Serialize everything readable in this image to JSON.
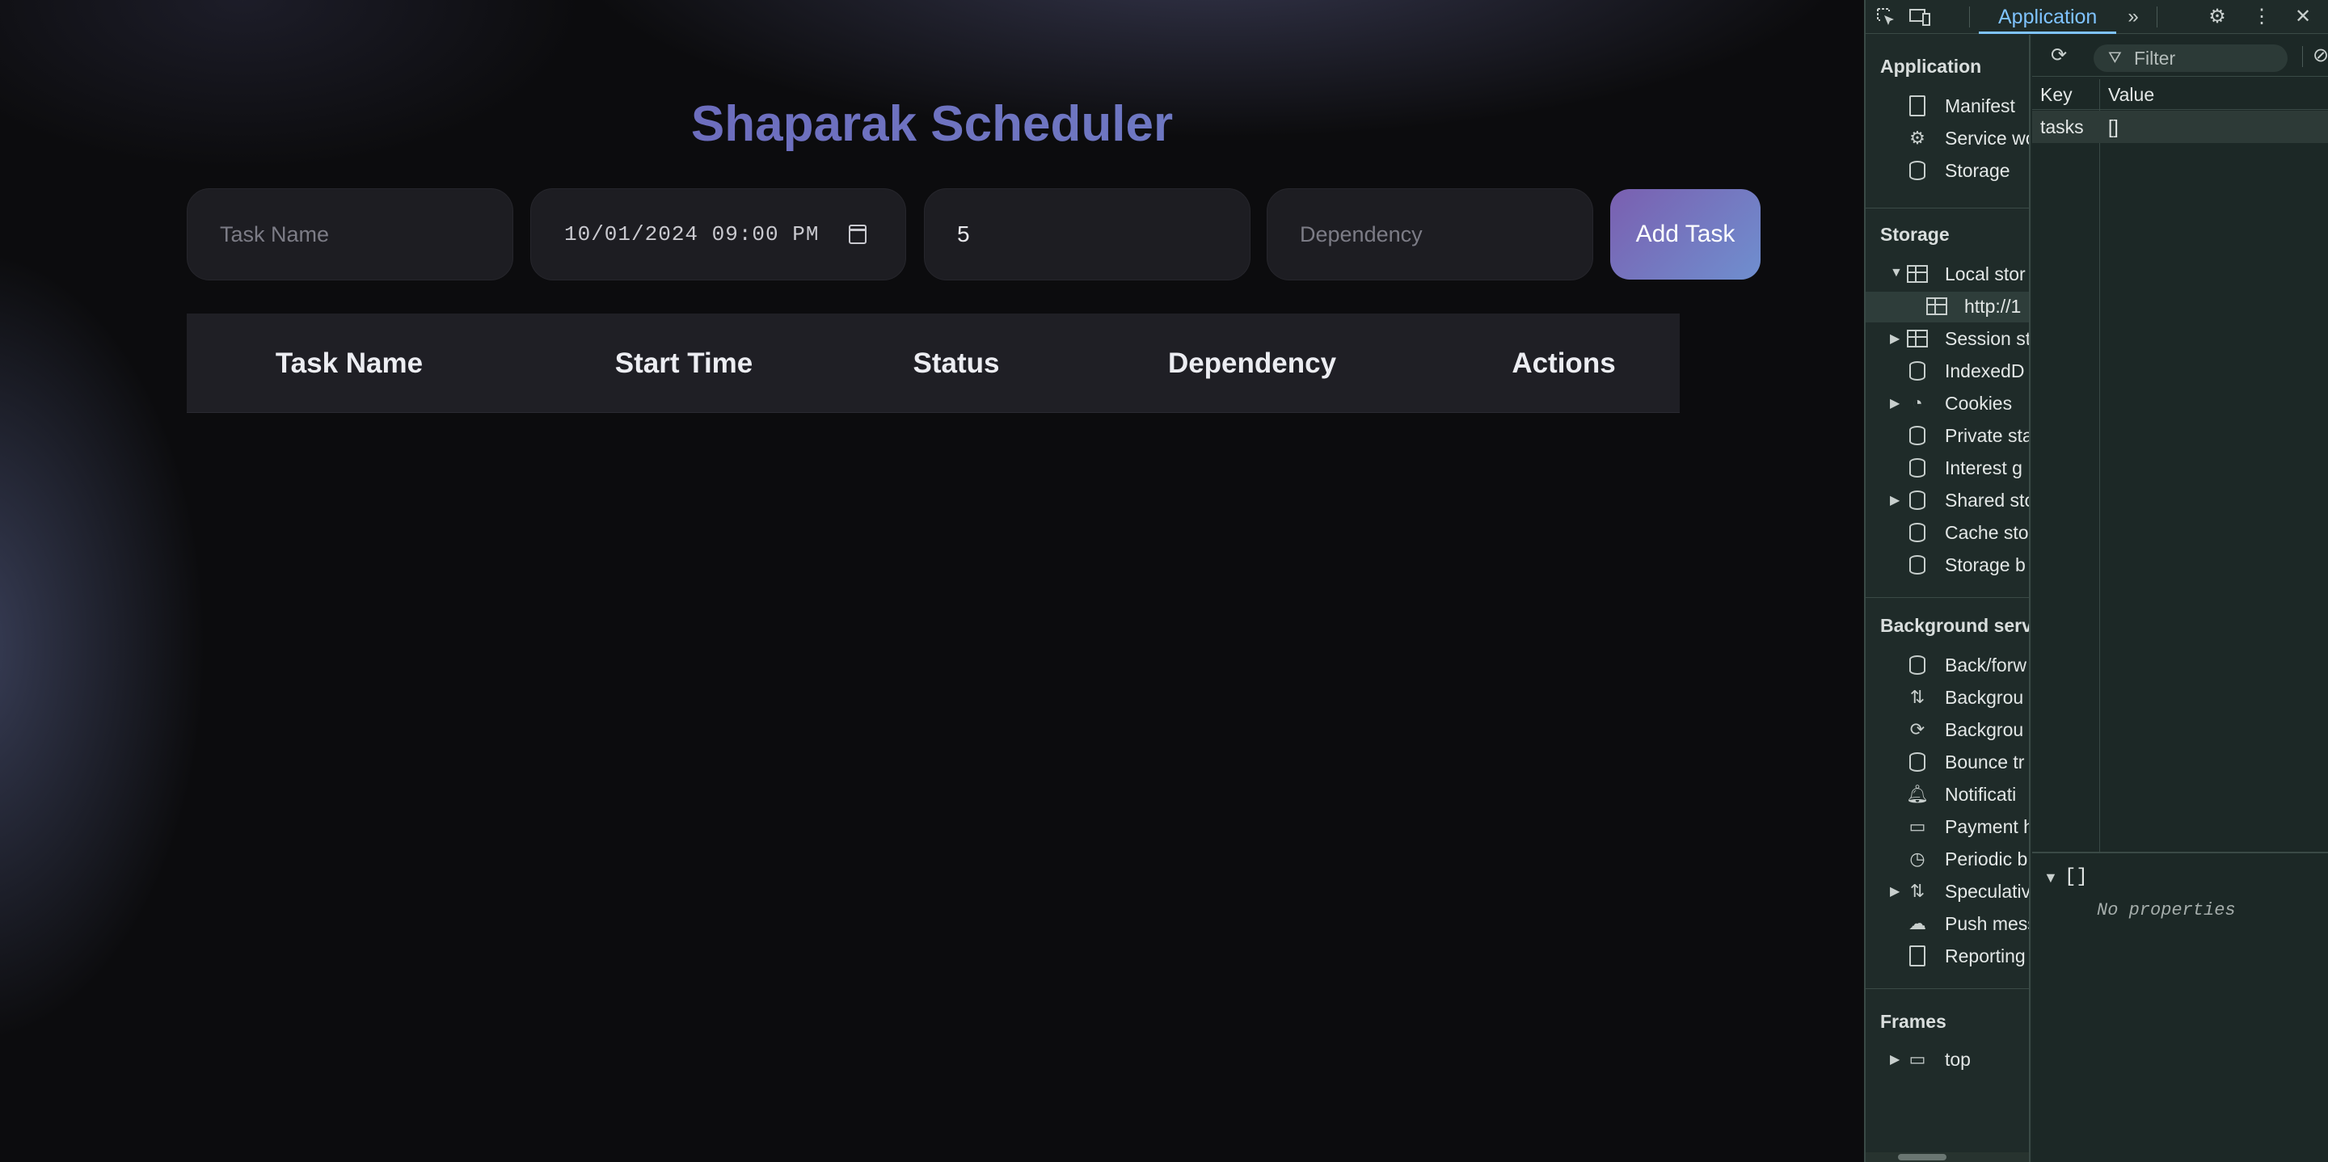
{
  "app": {
    "title": "Shaparak Scheduler",
    "task_name_placeholder": "Task Name",
    "start_time_value": "10/01/2024 09:00 PM",
    "duration_value": "5",
    "dependency_placeholder": "Dependency",
    "add_button": "Add Task",
    "table_headers": [
      "Task Name",
      "Start Time",
      "Status",
      "Dependency",
      "Actions"
    ],
    "colors": {
      "accent_start": "#7a5fb0",
      "accent_end": "#6f8fcf",
      "title": "#6f68c9"
    }
  },
  "devtools": {
    "active_tab": "Application",
    "sidebar": {
      "application_head": "Application",
      "application_items": [
        "Manifest",
        "Service wo",
        "Storage"
      ],
      "storage_head": "Storage",
      "storage_items": [
        "Local stor",
        "http://1",
        "Session st",
        "IndexedD",
        "Cookies",
        "Private sta",
        "Interest g",
        "Shared sto",
        "Cache sto",
        "Storage b"
      ],
      "background_head": "Background serv",
      "background_items": [
        "Back/forw",
        "Backgrou",
        "Backgrou",
        "Bounce tr",
        "Notificati",
        "Payment h",
        "Periodic b",
        "Speculativ",
        "Push mess",
        "Reporting"
      ],
      "frames_head": "Frames",
      "frames_items": [
        "top"
      ]
    },
    "filter_placeholder": "Filter",
    "table": {
      "key_header": "Key",
      "value_header": "Value",
      "row_key": "tasks",
      "row_value": "[]"
    },
    "preview_value": "[]",
    "preview_empty": "No properties"
  }
}
